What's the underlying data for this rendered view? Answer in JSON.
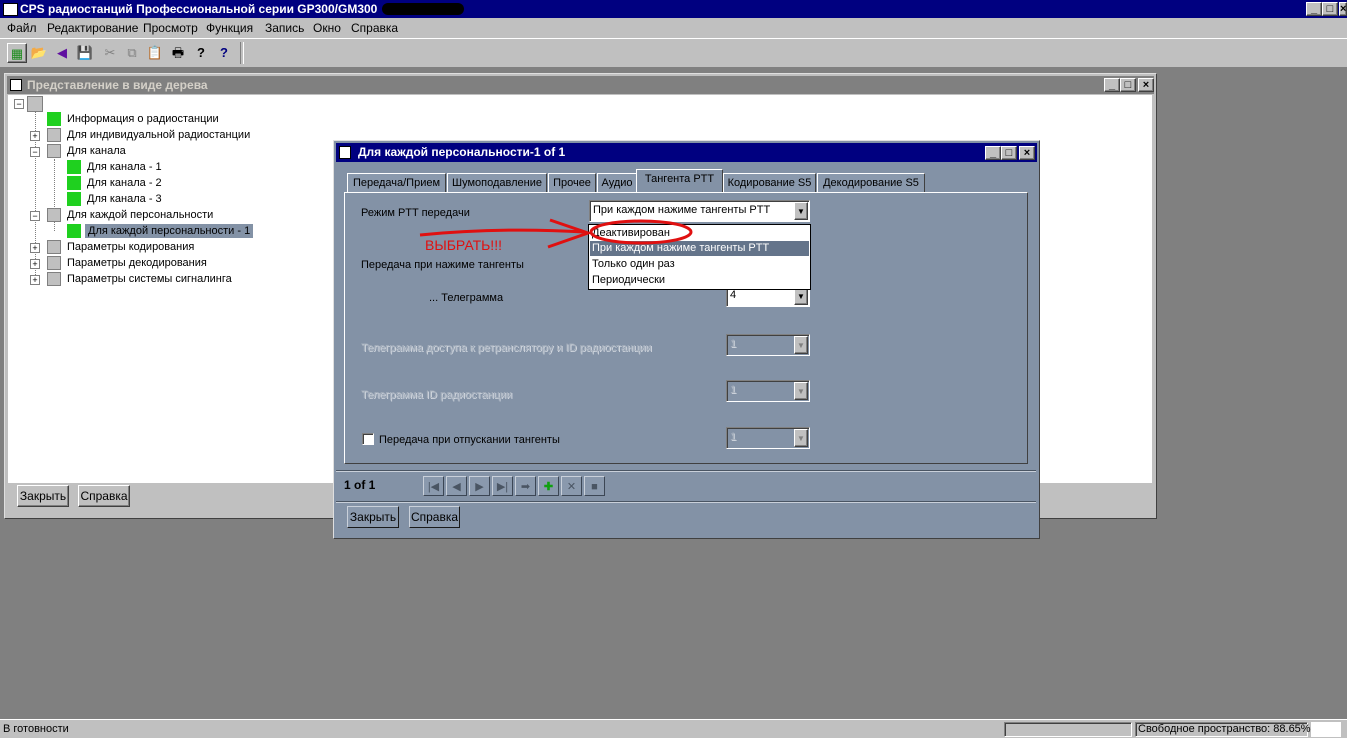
{
  "app": {
    "title": "CPS радиостанций Профессиональной серии GP300/GM300",
    "minimize": "_",
    "maximize": "□",
    "close": "×"
  },
  "menu": [
    "Файл",
    "Редактирование",
    "Просмотр",
    "Функция",
    "Запись",
    "Окно",
    "Справка"
  ],
  "toolbar": {
    "icons": [
      "tree-view-icon",
      "open-folder-icon",
      "back-icon",
      "save-icon",
      "cut-icon",
      "copy-icon",
      "paste-icon",
      "print-icon",
      "help-icon",
      "context-help-icon"
    ],
    "glyphs": [
      "▦",
      "📂",
      "◀",
      "💾",
      "✂",
      "⧉",
      "📋",
      "🖶",
      "?",
      "?"
    ]
  },
  "tree_window": {
    "title": "Представление в виде дерева",
    "items": [
      {
        "label": "Информация о радиостанции",
        "expander": ""
      },
      {
        "label": "Для индивидуальной радиостанции",
        "expander": "+"
      },
      {
        "label": "Для канала",
        "expander": "−"
      },
      {
        "label": "Для канала - 1",
        "expander": ""
      },
      {
        "label": "Для канала - 2",
        "expander": ""
      },
      {
        "label": "Для канала - 3",
        "expander": ""
      },
      {
        "label": "Для каждой персональности",
        "expander": "−"
      },
      {
        "label": "Для каждой персональности - 1",
        "expander": ""
      },
      {
        "label": "Параметры кодирования",
        "expander": "+"
      },
      {
        "label": "Параметры  декодирования",
        "expander": "+"
      },
      {
        "label": "Параметры системы сигналинга",
        "expander": "+"
      }
    ],
    "close_button": "Закрыть",
    "help_button": "Справка"
  },
  "dialog": {
    "title": "Для каждой персональности-1 of 1",
    "tabs": [
      "Передача/Прием",
      "Шумоподавление",
      "Прочее",
      "Аудио",
      "Тангента PTT",
      "Кодирование S5",
      "Декодирование S5"
    ],
    "active_tab": "Тангента PTT",
    "ptt_mode_label": "Режим PTT передачи",
    "ptt_mode_value": "При каждом нажиме тангенты PTT",
    "dropdown_options": [
      "Деактивирован",
      "При каждом нажиме тангенты PTT",
      "Только один раз",
      "Периодически"
    ],
    "dropdown_selected": "При каждом нажиме тангенты PTT",
    "annotation": "ВЫБРАТЬ!!!",
    "press_label": "Передача при нажиме тангенты",
    "telegram_label": "... Телеграмма",
    "telegram_value": "4",
    "repeater_label": "Телеграмма доступа к ретранслятору и ID радиостанции",
    "repeater_value": "1",
    "id_label": "Телеграмма ID радиостанции",
    "id_value": "1",
    "release_label": "Передача при отпускании тангенты",
    "release_value": "1",
    "record_counter": "1 of 1",
    "nav_glyphs": [
      "|◀",
      "◀",
      "▶",
      "▶|",
      "➡",
      "✚",
      "✕",
      "■"
    ],
    "close_button": "Закрыть",
    "help_button": "Справка"
  },
  "status": {
    "ready": "В готовности",
    "free_space": "Свободное пространство: 88.65%"
  },
  "colors": {
    "title_active": "#000080",
    "dialog_bg": "#8392a6",
    "annotation": "#e01010",
    "tree_icon_green": "#1fd01f"
  }
}
